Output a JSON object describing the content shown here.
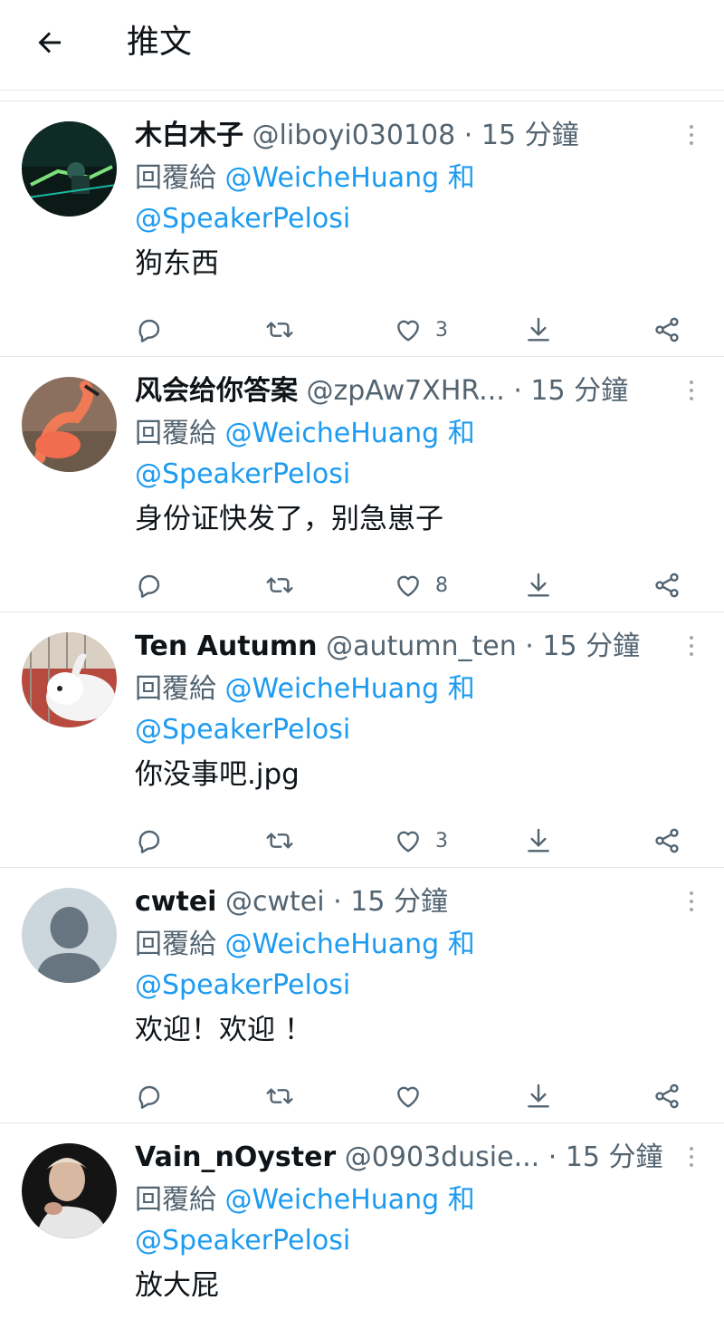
{
  "header": {
    "title": "推文"
  },
  "tweets": [
    {
      "name": "木白木子",
      "handle": "@liboyi030108",
      "time": "· 15 分鐘",
      "reply_prefix": "回覆給",
      "mention1": "@WeicheHuang",
      "conj": "和",
      "mention2": "@SpeakerPelosi",
      "text": "狗东西",
      "likes": "3"
    },
    {
      "name": "风会给你答案",
      "handle": "@zpAw7XHR...",
      "time": "· 15 分鐘",
      "reply_prefix": "回覆給",
      "mention1": "@WeicheHuang",
      "conj": "和",
      "mention2": "@SpeakerPelosi",
      "text": "身份证快发了，别急崽子",
      "likes": "8"
    },
    {
      "name": "Ten Autumn",
      "handle": "@autumn_ten",
      "time": "· 15 分鐘",
      "reply_prefix": "回覆給",
      "mention1": "@WeicheHuang",
      "conj": "和",
      "mention2": "@SpeakerPelosi",
      "text": "你没事吧.jpg",
      "likes": "3"
    },
    {
      "name": "cwtei",
      "handle": "@cwtei",
      "time": "· 15 分鐘",
      "reply_prefix": "回覆給",
      "mention1": "@WeicheHuang",
      "conj": "和",
      "mention2": "@SpeakerPelosi",
      "text": "欢迎！欢迎 ！",
      "likes": ""
    },
    {
      "name": "Vain_nOyster",
      "handle": "@0903dusie...",
      "time": "· 15 分鐘",
      "reply_prefix": "回覆給",
      "mention1": "@WeicheHuang",
      "conj": "和",
      "mention2": "@SpeakerPelosi",
      "text": "放大屁",
      "likes": ""
    }
  ],
  "icons": {
    "back": "arrow-left-icon",
    "reply": "speech-bubble-icon",
    "retweet": "retweet-icon",
    "like": "heart-icon",
    "download": "download-icon",
    "share": "share-icon",
    "more": "vertical-dots-icon"
  },
  "colors": {
    "mention": "#1d9bf0",
    "secondary_text": "#536471",
    "primary_text": "#0f1419",
    "divider": "#e6e6e6"
  }
}
